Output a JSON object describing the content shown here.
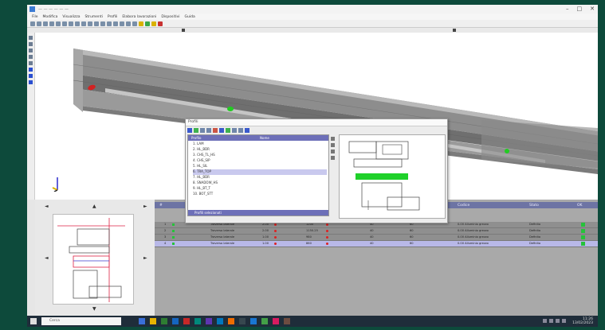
{
  "window": {
    "title": "— — — — — —"
  },
  "menu": [
    "File",
    "Modifica",
    "Visualizza",
    "Strumenti",
    "Profili",
    "Elabora lavorazioni",
    "Dispositivi",
    "Guida"
  ],
  "dialog": {
    "title": "Profili",
    "columns": [
      "Profilo",
      "Nome"
    ],
    "items": [
      "1. LAM",
      "2. HL_BDR",
      "3. CHS_TL_HS",
      "4. CHS_SIP",
      "5. HL_SIL",
      "6. TRA_TOP",
      "7. HL_BDR",
      "8. SNADOW_HS",
      "9. HL_BT_T",
      "10. BOT_STT"
    ],
    "selected_index": 5,
    "footer": "Profili selezionati"
  },
  "grid": {
    "headers": [
      "#",
      "",
      "",
      "Descrizione",
      "Quantità",
      "",
      "Lung.",
      "",
      "",
      "",
      "Codice",
      "Stato",
      "",
      "OK"
    ],
    "rows": [
      {
        "num": "1",
        "desc": "Traverso laterale",
        "qty": "2.00",
        "len": "1200",
        "a": "40",
        "b": "60",
        "code": "0.00  Alluminio grezzo",
        "state": "Definito"
      },
      {
        "num": "2",
        "desc": "Traverso laterale",
        "qty": "2.00",
        "len": "1150.25",
        "a": "40",
        "b": "60",
        "code": "0.00  Alluminio grezzo",
        "state": "Definito"
      },
      {
        "num": "3",
        "desc": "Traverso laterale",
        "qty": "1.00",
        "len": "980",
        "a": "40",
        "b": "60",
        "code": "0.00  Alluminio grezzo",
        "state": "Definito"
      },
      {
        "num": "4",
        "desc": "Traverso laterale",
        "qty": "1.00",
        "len": "860",
        "a": "40",
        "b": "60",
        "code": "0.00  Alluminio grezzo",
        "state": "Definito"
      }
    ],
    "selected_row": 3
  },
  "taskbar": {
    "search_placeholder": "Cerca",
    "time": "11:26",
    "date": "13/02/2023"
  },
  "colors": {
    "accent": "#6d6fb8",
    "marker_red": "#d22222",
    "marker_green": "#22cc22",
    "preview_bar": "#1fd12a"
  }
}
